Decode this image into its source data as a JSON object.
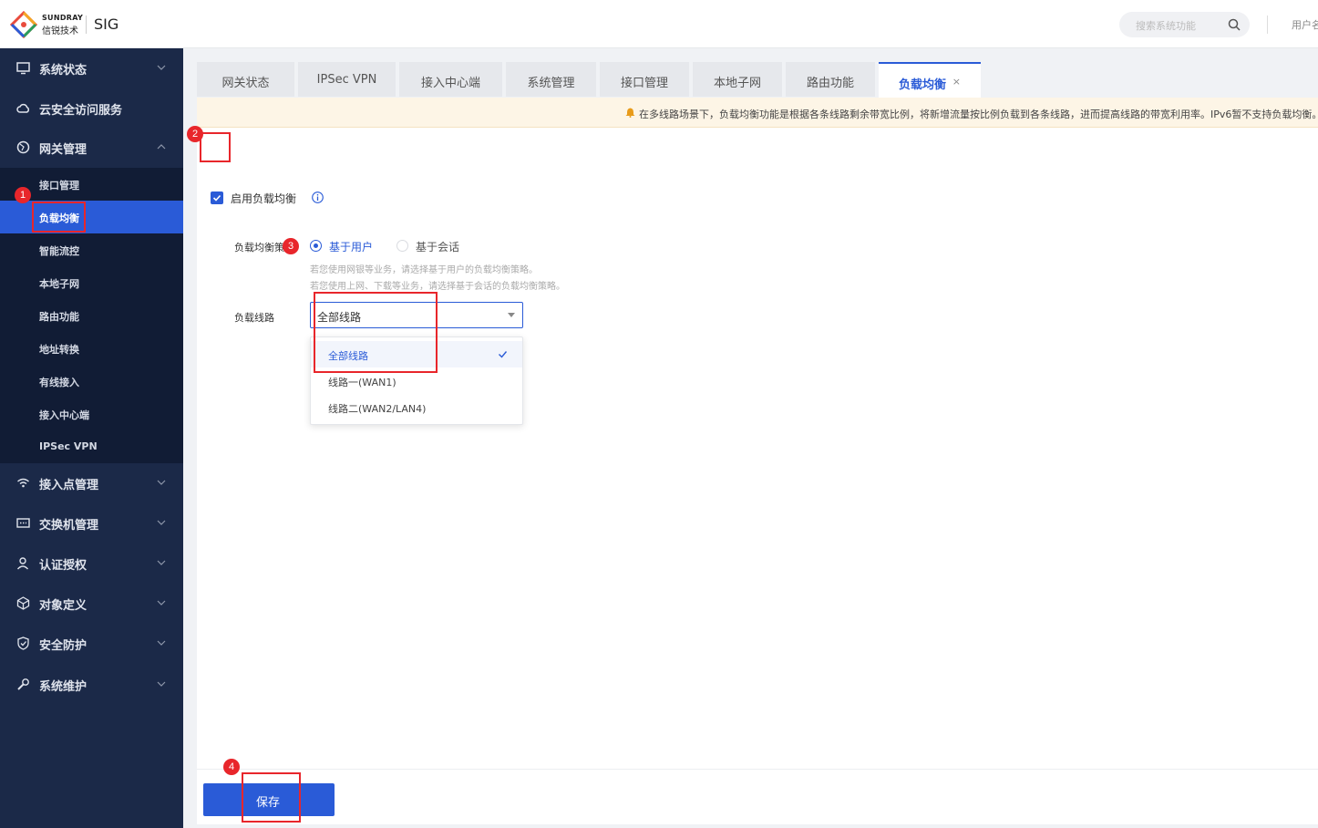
{
  "header": {
    "brand_top": "SUNDRAY",
    "brand_bottom": "信锐技术",
    "app_name": "SIG",
    "search_placeholder": "搜索系统功能",
    "user_label": "用户名"
  },
  "sidebar": {
    "items": [
      {
        "label": "系统状态",
        "icon": "monitor-icon"
      },
      {
        "label": "云安全访问服务",
        "icon": "cloud-icon"
      },
      {
        "label": "网关管理",
        "icon": "globe-icon"
      },
      {
        "label": "接入点管理",
        "icon": "wifi-icon"
      },
      {
        "label": "交换机管理",
        "icon": "switch-icon"
      },
      {
        "label": "认证授权",
        "icon": "user-icon"
      },
      {
        "label": "对象定义",
        "icon": "cube-icon"
      },
      {
        "label": "安全防护",
        "icon": "shield-icon"
      },
      {
        "label": "系统维护",
        "icon": "wrench-icon"
      }
    ],
    "sub_items": [
      "接口管理",
      "负载均衡",
      "智能流控",
      "本地子网",
      "路由功能",
      "地址转换",
      "有线接入",
      "接入中心端",
      "IPSec VPN"
    ],
    "active_sub": "负载均衡"
  },
  "tabs": [
    "网关状态",
    "IPSec VPN",
    "接入中心端",
    "系统管理",
    "接口管理",
    "本地子网",
    "路由功能",
    "负载均衡"
  ],
  "active_tab": "负载均衡",
  "tab_close": "×",
  "notice": "在多线路场景下，负载均衡功能是根据各条线路剩余带宽比例，将新增流量按比例负载到各条线路，进而提高线路的带宽利用率。IPv6暂不支持负载均衡。",
  "form": {
    "enable_label": "启用负载均衡",
    "enable_checked": true,
    "strategy_label": "负载均衡策略",
    "strategy_options": [
      "基于用户",
      "基于会话"
    ],
    "strategy_selected": "基于用户",
    "hint1": "若您使用网银等业务，请选择基于用户的负载均衡策略。",
    "hint2": "若您使用上网、下载等业务，请选择基于会话的负载均衡策略。",
    "line_label": "负载线路",
    "line_value": "全部线路",
    "line_options": [
      "全部线路",
      "线路一(WAN1)",
      "线路二(WAN2/LAN4)"
    ],
    "line_selected": "全部线路"
  },
  "save_label": "保存",
  "annotations": [
    "1",
    "2",
    "3",
    "4"
  ],
  "colors": {
    "accent": "#2a5bd7",
    "sidebar": "#1b2948",
    "sidebar_sub": "#111c35",
    "annotation": "#e8262b"
  }
}
